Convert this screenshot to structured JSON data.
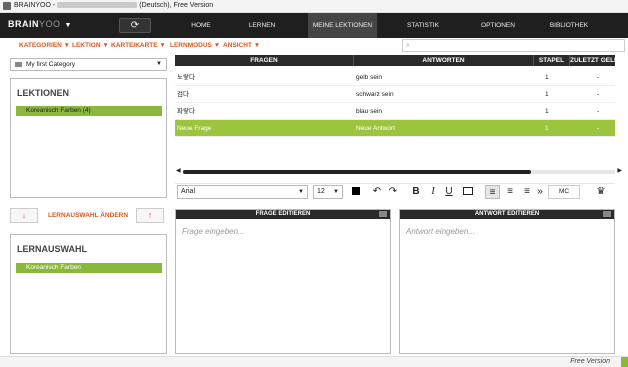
{
  "window": {
    "title_prefix": "BRAINYOO -",
    "title_suffix": "(Deutsch), Free Version"
  },
  "navbar": {
    "logo_main": "BRAIN",
    "logo_sub": "YOO",
    "logo_arrow": "▼",
    "sync_icon": "⟳",
    "tabs": [
      "HOME",
      "LERNEN",
      "MEINE LEKTIONEN",
      "STATISTIK",
      "OPTIONEN",
      "BIBLIOTHEK"
    ],
    "active_tab": "MEINE LEKTIONEN"
  },
  "menu": [
    "KATEGORIEN ▼",
    "LEKTION ▼",
    "KARTEIKARTE ▼",
    "LERNMODUS ▼",
    "ANSICHT ▼"
  ],
  "search": {
    "placeholder": ""
  },
  "category": {
    "selected": "My first Category",
    "arrow": "▼"
  },
  "lektionen": {
    "heading": "LEKTIONEN",
    "items": [
      "Koreanisch Farben (4)"
    ]
  },
  "lernauswahl": {
    "button_label": "LERNAUSWAHL ÄNDERN",
    "down_arrow": "↓",
    "up_arrow": "↑",
    "heading": "LERNAUSWAHL",
    "items": [
      "Koreanisch Farben"
    ]
  },
  "grid": {
    "columns": [
      "FRAGEN",
      "ANTWORTEN",
      "STAPEL",
      "ZULETZT GELE"
    ],
    "rows": [
      {
        "frage": "노랗다",
        "antwort": "gelb sein",
        "stapel": "1",
        "zuletzt": "-"
      },
      {
        "frage": "검다",
        "antwort": "schwarz sein",
        "stapel": "1",
        "zuletzt": "-"
      },
      {
        "frage": "파랗다",
        "antwort": "blau sein",
        "stapel": "1",
        "zuletzt": "-"
      },
      {
        "frage": "Neue Frage",
        "antwort": "Neue Antwort",
        "stapel": "1",
        "zuletzt": "-"
      }
    ],
    "selected_row": 3
  },
  "toolbar": {
    "font": "Arial",
    "size": "12",
    "bold": "B",
    "italic": "I",
    "underline": "U",
    "more": "»",
    "mc": "MC"
  },
  "editors": {
    "frage_title": "FRAGE EDITIEREN",
    "frage_placeholder": "Frage eingeben...",
    "antwort_title": "ANTWORT EDITIEREN",
    "antwort_placeholder": "Antwort eingeben..."
  },
  "status": {
    "version": "Free Version"
  },
  "colors": {
    "accent": "#e2571e",
    "selection": "#9cc43f",
    "nav": "#1f1f1f"
  }
}
